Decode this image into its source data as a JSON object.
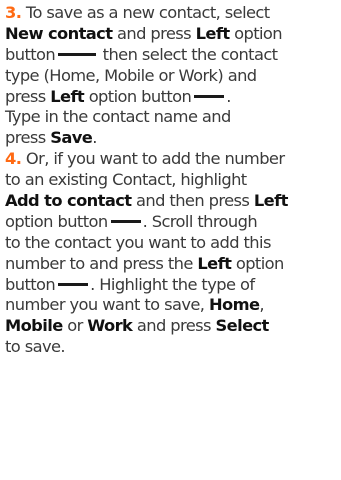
{
  "step3": {
    "number": "3.",
    "l1_text": " To save as a new contact, select",
    "l2_b1": "New contact",
    "l2_t1": " and press ",
    "l2_b2": "Left",
    "l2_t2": " option",
    "l3_t1": "button",
    "l3_t2": " then select the contact",
    "l4_text": "type (Home, Mobile or Work) and",
    "l5_t1": "press ",
    "l5_b1": "Left",
    "l5_t2": " option button",
    "l5_t3": ".",
    "l6_text": "Type in the contact name and",
    "l7_t1": "press ",
    "l7_b1": "Save",
    "l7_t2": "."
  },
  "step4": {
    "number": "4.",
    "l1_text": " Or, if you want to add the number",
    "l2_text": "to an existing Contact, highlight",
    "l3_b1": "Add to contact",
    "l3_t1": " and then press ",
    "l3_b2": "Left",
    "l4_t1": "option button",
    "l4_t2": ". Scroll through",
    "l5_text": "to the contact you want to add this",
    "l6_t1": "number to and press the ",
    "l6_b1": "Left",
    "l6_t2": " option",
    "l7_t1": "button",
    "l7_t2": ". Highlight the type of",
    "l8_t1": "number you want to save, ",
    "l8_b1": "Home",
    "l8_t2": ",",
    "l9_b1": "Mobile",
    "l9_t1": " or ",
    "l9_b2": "Work",
    "l9_t2": " and press ",
    "l9_b3": "Select",
    "l10_text": "to save."
  },
  "colors": {
    "step_number": "#ff6a13",
    "text": "#3a3a3a",
    "bold": "#111111"
  },
  "icons": {
    "option_button": "dash-icon"
  }
}
